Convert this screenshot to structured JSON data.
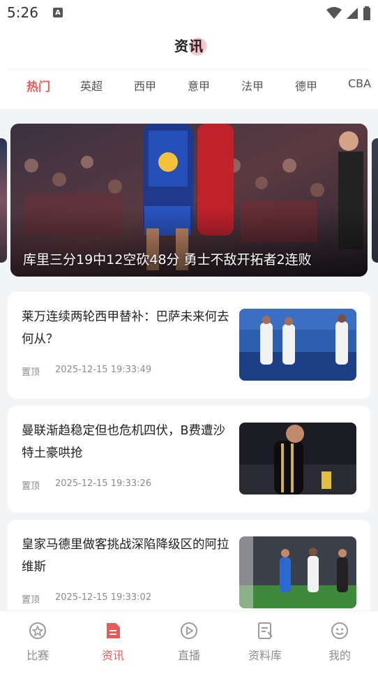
{
  "status": {
    "time": "5:26",
    "app_badge": "A"
  },
  "header": {
    "title": "资讯"
  },
  "tabs": [
    "热门",
    "英超",
    "西甲",
    "意甲",
    "法甲",
    "德甲",
    "CBA"
  ],
  "hero": {
    "caption": "库里三分19中12空砍48分 勇士不敌开拓者2连败"
  },
  "news": [
    {
      "title": "莱万连续两轮西甲替补：巴萨未来何去何从？",
      "tag": "置顶",
      "time": "2025-12-15 19:33:49"
    },
    {
      "title": "曼联渐趋稳定但也危机四伏，B费遭沙特土豪哄抢",
      "tag": "置顶",
      "time": "2025-12-15 19:33:26"
    },
    {
      "title": "皇家马德里做客挑战深陷降级区的阿拉维斯",
      "tag": "置顶",
      "time": "2025-12-15 19:33:02"
    }
  ],
  "bottom_nav": [
    {
      "label": "比赛",
      "icon": "match-icon"
    },
    {
      "label": "资讯",
      "icon": "news-icon"
    },
    {
      "label": "直播",
      "icon": "live-icon"
    },
    {
      "label": "资料库",
      "icon": "database-icon"
    },
    {
      "label": "我的",
      "icon": "profile-icon"
    }
  ],
  "colors": {
    "accent": "#e85a5a",
    "inactive": "#8e8e8e",
    "background": "#f3f4f6"
  }
}
